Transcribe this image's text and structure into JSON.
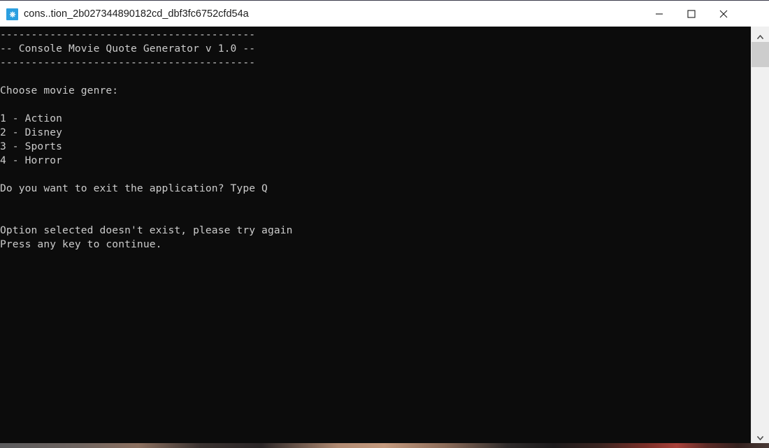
{
  "window": {
    "title": "cons..tion_2b027344890182cd_dbf3fc6752cfd54a",
    "icon": "console-app-icon",
    "icon_glyph": "⎈",
    "controls": {
      "minimize": "minimize-icon",
      "maximize": "maximize-icon",
      "close": "close-icon"
    },
    "titlebar_bg": "#ffffff",
    "titlebar_text_color": "#1b1b1b"
  },
  "console": {
    "background": "#0c0c0c",
    "foreground": "#cccccc",
    "lines": [
      "-----------------------------------------",
      "-- Console Movie Quote Generator v 1.0 --",
      "-----------------------------------------",
      "",
      "Choose movie genre:",
      "",
      "1 - Action",
      "2 - Disney",
      "3 - Sports",
      "4 - Horror",
      "",
      "Do you want to exit the application? Type Q",
      "",
      "",
      "Option selected doesn't exist, please try again",
      "Press any key to continue."
    ],
    "text": "-----------------------------------------\n-- Console Movie Quote Generator v 1.0 --\n-----------------------------------------\n\nChoose movie genre:\n\n1 - Action\n2 - Disney\n3 - Sports\n4 - Horror\n\nDo you want to exit the application? Type Q\n\n\nOption selected doesn't exist, please try again\nPress any key to continue.",
    "header": {
      "separator": "-----------------------------------------",
      "title": "-- Console Movie Quote Generator v 1.0 --",
      "app_name": "Console Movie Quote Generator",
      "version": "v 1.0"
    },
    "prompt": "Choose movie genre:",
    "menu": [
      {
        "key": "1",
        "separator": "-",
        "label": "Action"
      },
      {
        "key": "2",
        "separator": "-",
        "label": "Disney"
      },
      {
        "key": "3",
        "separator": "-",
        "label": "Sports"
      },
      {
        "key": "4",
        "separator": "-",
        "label": "Horror"
      }
    ],
    "exit_prompt": "Do you want to exit the application? Type Q",
    "error_message": "Option selected doesn't exist, please try again",
    "continue_message": "Press any key to continue."
  },
  "scrollbar": {
    "up_arrow": "chevron-up-icon",
    "down_arrow": "chevron-down-icon",
    "thumb_color": "#cdcdcd",
    "track_color": "#f0f0f0"
  }
}
